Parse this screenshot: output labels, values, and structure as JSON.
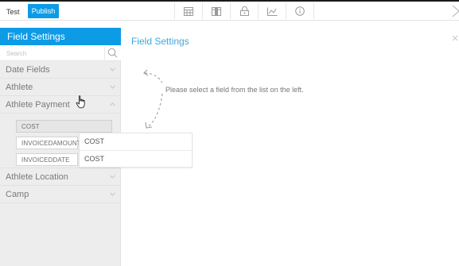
{
  "topbar": {
    "test_label": "Test",
    "publish_label": "Publish",
    "icons": [
      "table-icon",
      "column-icon",
      "lock-icon",
      "chart-icon",
      "info-icon"
    ]
  },
  "sidebar": {
    "title": "Field Settings",
    "search_placeholder": "Search",
    "categories": [
      {
        "label": "Date Fields",
        "expanded": false
      },
      {
        "label": "Athlete",
        "expanded": false
      },
      {
        "label": "Athlete Payment",
        "expanded": true
      },
      {
        "label": "Athlete Location",
        "expanded": false
      },
      {
        "label": "Camp",
        "expanded": false
      }
    ],
    "fields": [
      {
        "label": "COST",
        "active": true
      },
      {
        "label": "INVOICEDAMOUNT",
        "active": false
      },
      {
        "label": "INVOICEDDATE",
        "active": false
      }
    ]
  },
  "popup": {
    "items": [
      "COST",
      "COST"
    ]
  },
  "main": {
    "title": "Field Settings",
    "hint": "Please select a field from the list on the left."
  },
  "colors": {
    "accent": "#0d9be6",
    "title_blue": "#3da6de",
    "list_bg": "#ededed"
  }
}
